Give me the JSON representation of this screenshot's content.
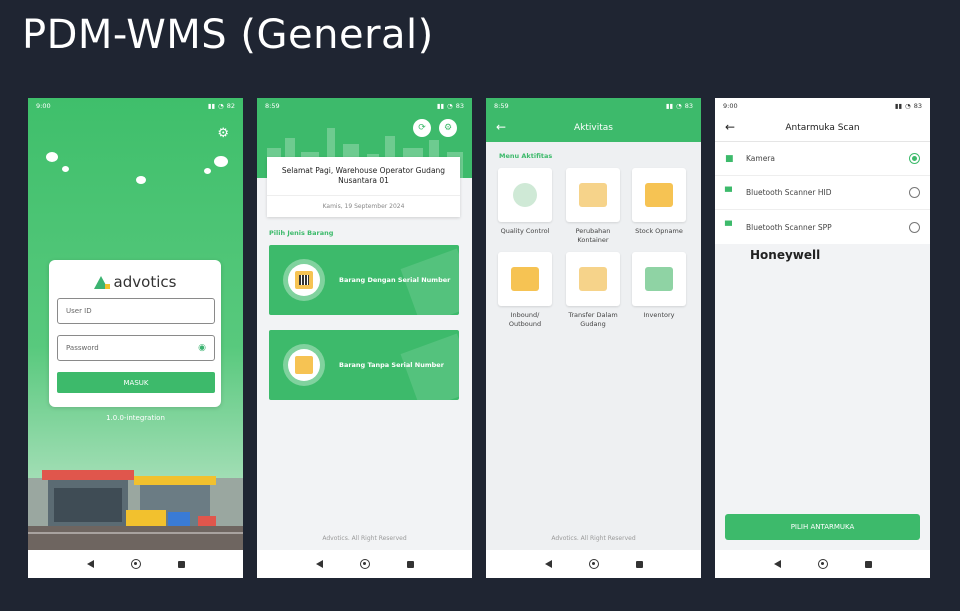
{
  "page_title": "PDM-WMS (General)",
  "colors": {
    "background": "#1f2532",
    "brand_green": "#3dba6b",
    "accent_yellow": "#f6c353"
  },
  "screens": [
    {
      "status": {
        "time": "9:00",
        "battery": "82"
      },
      "login": {
        "brand": "advotics",
        "user_placeholder": "User ID",
        "password_placeholder": "Password",
        "submit_label": "MASUK",
        "version": "1.0.0-integration"
      }
    },
    {
      "status": {
        "time": "8:59",
        "battery": "83"
      },
      "greeting": "Selamat Pagi, Warehouse Operator Gudang Nusantara 01",
      "date": "Kamis, 19 September 2024",
      "section_label": "Pilih Jenis Barang",
      "options": [
        {
          "label": "Barang Dengan Serial Number",
          "icon": "barcode-box-icon"
        },
        {
          "label": "Barang Tanpa Serial Number",
          "icon": "box-icon"
        }
      ],
      "footer": "Advotics. All Right Reserved"
    },
    {
      "status": {
        "time": "8:59",
        "battery": "83"
      },
      "title": "Aktivitas",
      "section_label": "Menu Aktifitas",
      "menu": [
        {
          "label": "Quality Control",
          "icon": "medal-icon",
          "color": "#cfe9d6"
        },
        {
          "label": "Perubahan Kontainer",
          "icon": "container-icon",
          "color": "#f6d38a"
        },
        {
          "label": "Stock Opname",
          "icon": "stock-boxes-icon",
          "color": "#f6c353"
        },
        {
          "label": "Inbound/ Outbound",
          "icon": "truck-icon",
          "color": "#f6c353"
        },
        {
          "label": "Transfer Dalam Gudang",
          "icon": "hand-truck-icon",
          "color": "#f6d38a"
        },
        {
          "label": "Inventory",
          "icon": "warehouse-icon",
          "color": "#8fd3a4"
        }
      ],
      "footer": "Advotics. All Right Reserved"
    },
    {
      "status": {
        "time": "9:00",
        "battery": "83"
      },
      "title": "Antarmuka Scan",
      "options": [
        {
          "label": "Kamera",
          "icon": "camera-icon",
          "selected": true
        },
        {
          "label": "Bluetooth Scanner HID",
          "icon": "scanner-icon",
          "selected": false
        },
        {
          "label": "Bluetooth Scanner SPP",
          "icon": "scanner-icon",
          "selected": false
        }
      ],
      "brand_text": "Honeywell",
      "submit_label": "PILIH ANTARMUKA"
    }
  ]
}
